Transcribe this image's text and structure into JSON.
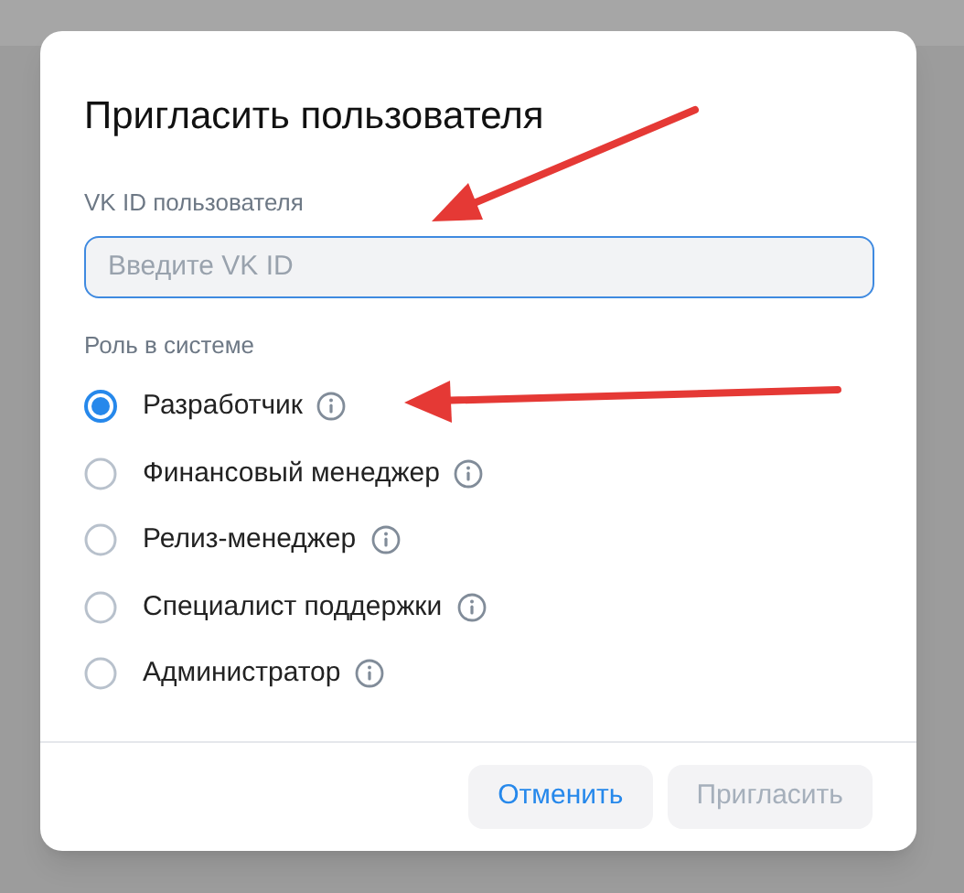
{
  "dialog": {
    "title": "Пригласить пользователя",
    "field": {
      "label": "VK ID пользователя",
      "placeholder": "Введите VK ID",
      "focused": true
    },
    "roles_label": "Роль в системе",
    "roles": [
      {
        "label": "Разработчик",
        "selected": true
      },
      {
        "label": "Финансовый менеджер",
        "selected": false
      },
      {
        "label": "Релиз-менеджер",
        "selected": false
      },
      {
        "label": "Специалист поддержки",
        "selected": false
      },
      {
        "label": "Администратор",
        "selected": false
      }
    ],
    "buttons": [
      {
        "label": "Отменить",
        "disabled": false
      },
      {
        "label": "Пригласить",
        "disabled": true
      }
    ]
  }
}
